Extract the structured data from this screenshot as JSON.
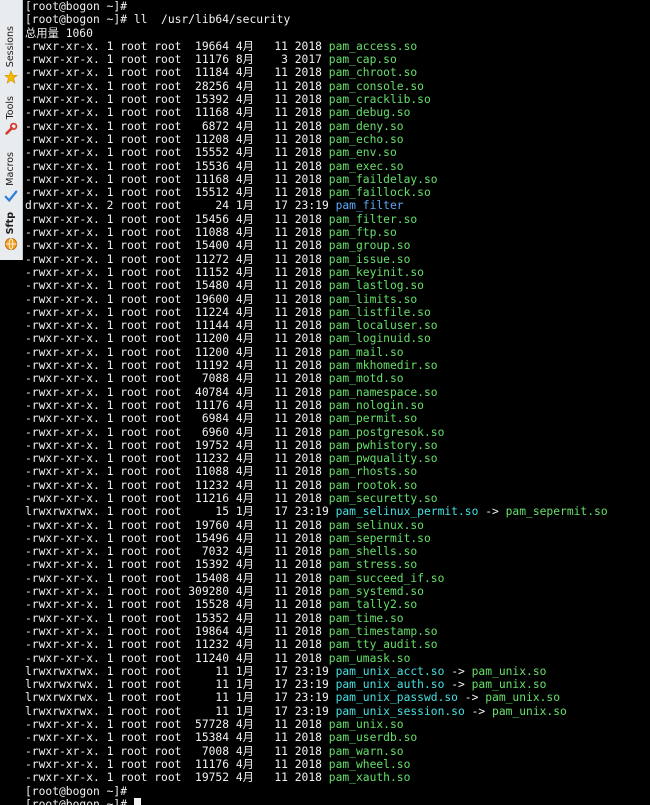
{
  "sidebar": {
    "tabs": [
      {
        "label": "Sessions",
        "icon": "star-icon"
      },
      {
        "label": "Tools",
        "icon": "wrench-icon"
      },
      {
        "label": "Macros",
        "icon": "checkmark-icon"
      },
      {
        "label": "Sftp",
        "icon": "globe-icon"
      }
    ]
  },
  "terminal": {
    "colors": {
      "executable": "#66e06a",
      "directory": "#5ba7f7",
      "symlink": "#47e0e0",
      "text": "#f2f2f2"
    },
    "lines": [
      {
        "text": "[root@bogon ~]#"
      },
      {
        "text": "[root@bogon ~]# ll  /usr/lib64/security"
      },
      {
        "text": "总用量 1060"
      },
      {
        "prefix": "-rwxr-xr-x. 1 root root  19664 4月   11 2018 ",
        "name": "pam_access.so",
        "type": "exec"
      },
      {
        "prefix": "-rwxr-xr-x. 1 root root  11176 8月    3 2017 ",
        "name": "pam_cap.so",
        "type": "exec"
      },
      {
        "prefix": "-rwxr-xr-x. 1 root root  11184 4月   11 2018 ",
        "name": "pam_chroot.so",
        "type": "exec"
      },
      {
        "prefix": "-rwxr-xr-x. 1 root root  28256 4月   11 2018 ",
        "name": "pam_console.so",
        "type": "exec"
      },
      {
        "prefix": "-rwxr-xr-x. 1 root root  15392 4月   11 2018 ",
        "name": "pam_cracklib.so",
        "type": "exec"
      },
      {
        "prefix": "-rwxr-xr-x. 1 root root  11168 4月   11 2018 ",
        "name": "pam_debug.so",
        "type": "exec"
      },
      {
        "prefix": "-rwxr-xr-x. 1 root root   6872 4月   11 2018 ",
        "name": "pam_deny.so",
        "type": "exec"
      },
      {
        "prefix": "-rwxr-xr-x. 1 root root  11208 4月   11 2018 ",
        "name": "pam_echo.so",
        "type": "exec"
      },
      {
        "prefix": "-rwxr-xr-x. 1 root root  15552 4月   11 2018 ",
        "name": "pam_env.so",
        "type": "exec"
      },
      {
        "prefix": "-rwxr-xr-x. 1 root root  15536 4月   11 2018 ",
        "name": "pam_exec.so",
        "type": "exec"
      },
      {
        "prefix": "-rwxr-xr-x. 1 root root  11168 4月   11 2018 ",
        "name": "pam_faildelay.so",
        "type": "exec"
      },
      {
        "prefix": "-rwxr-xr-x. 1 root root  15512 4月   11 2018 ",
        "name": "pam_faillock.so",
        "type": "exec"
      },
      {
        "prefix": "drwxr-xr-x. 2 root root     24 1月   17 23:19 ",
        "name": "pam_filter",
        "type": "dir"
      },
      {
        "prefix": "-rwxr-xr-x. 1 root root  15456 4月   11 2018 ",
        "name": "pam_filter.so",
        "type": "exec"
      },
      {
        "prefix": "-rwxr-xr-x. 1 root root  11088 4月   11 2018 ",
        "name": "pam_ftp.so",
        "type": "exec"
      },
      {
        "prefix": "-rwxr-xr-x. 1 root root  15400 4月   11 2018 ",
        "name": "pam_group.so",
        "type": "exec"
      },
      {
        "prefix": "-rwxr-xr-x. 1 root root  11272 4月   11 2018 ",
        "name": "pam_issue.so",
        "type": "exec"
      },
      {
        "prefix": "-rwxr-xr-x. 1 root root  11152 4月   11 2018 ",
        "name": "pam_keyinit.so",
        "type": "exec"
      },
      {
        "prefix": "-rwxr-xr-x. 1 root root  15480 4月   11 2018 ",
        "name": "pam_lastlog.so",
        "type": "exec"
      },
      {
        "prefix": "-rwxr-xr-x. 1 root root  19600 4月   11 2018 ",
        "name": "pam_limits.so",
        "type": "exec"
      },
      {
        "prefix": "-rwxr-xr-x. 1 root root  11224 4月   11 2018 ",
        "name": "pam_listfile.so",
        "type": "exec"
      },
      {
        "prefix": "-rwxr-xr-x. 1 root root  11144 4月   11 2018 ",
        "name": "pam_localuser.so",
        "type": "exec"
      },
      {
        "prefix": "-rwxr-xr-x. 1 root root  11200 4月   11 2018 ",
        "name": "pam_loginuid.so",
        "type": "exec"
      },
      {
        "prefix": "-rwxr-xr-x. 1 root root  11200 4月   11 2018 ",
        "name": "pam_mail.so",
        "type": "exec"
      },
      {
        "prefix": "-rwxr-xr-x. 1 root root  11192 4月   11 2018 ",
        "name": "pam_mkhomedir.so",
        "type": "exec"
      },
      {
        "prefix": "-rwxr-xr-x. 1 root root   7088 4月   11 2018 ",
        "name": "pam_motd.so",
        "type": "exec"
      },
      {
        "prefix": "-rwxr-xr-x. 1 root root  40784 4月   11 2018 ",
        "name": "pam_namespace.so",
        "type": "exec"
      },
      {
        "prefix": "-rwxr-xr-x. 1 root root  11176 4月   11 2018 ",
        "name": "pam_nologin.so",
        "type": "exec"
      },
      {
        "prefix": "-rwxr-xr-x. 1 root root   6984 4月   11 2018 ",
        "name": "pam_permit.so",
        "type": "exec"
      },
      {
        "prefix": "-rwxr-xr-x. 1 root root   6960 4月   11 2018 ",
        "name": "pam_postgresok.so",
        "type": "exec"
      },
      {
        "prefix": "-rwxr-xr-x. 1 root root  19752 4月   11 2018 ",
        "name": "pam_pwhistory.so",
        "type": "exec"
      },
      {
        "prefix": "-rwxr-xr-x. 1 root root  11232 4月   11 2018 ",
        "name": "pam_pwquality.so",
        "type": "exec"
      },
      {
        "prefix": "-rwxr-xr-x. 1 root root  11088 4月   11 2018 ",
        "name": "pam_rhosts.so",
        "type": "exec"
      },
      {
        "prefix": "-rwxr-xr-x. 1 root root  11232 4月   11 2018 ",
        "name": "pam_rootok.so",
        "type": "exec"
      },
      {
        "prefix": "-rwxr-xr-x. 1 root root  11216 4月   11 2018 ",
        "name": "pam_securetty.so",
        "type": "exec"
      },
      {
        "prefix": "lrwxrwxrwx. 1 root root     15 1月   17 23:19 ",
        "name": "pam_selinux_permit.so",
        "type": "link",
        "target": "pam_sepermit.so"
      },
      {
        "prefix": "-rwxr-xr-x. 1 root root  19760 4月   11 2018 ",
        "name": "pam_selinux.so",
        "type": "exec"
      },
      {
        "prefix": "-rwxr-xr-x. 1 root root  15496 4月   11 2018 ",
        "name": "pam_sepermit.so",
        "type": "exec"
      },
      {
        "prefix": "-rwxr-xr-x. 1 root root   7032 4月   11 2018 ",
        "name": "pam_shells.so",
        "type": "exec"
      },
      {
        "prefix": "-rwxr-xr-x. 1 root root  15392 4月   11 2018 ",
        "name": "pam_stress.so",
        "type": "exec"
      },
      {
        "prefix": "-rwxr-xr-x. 1 root root  15408 4月   11 2018 ",
        "name": "pam_succeed_if.so",
        "type": "exec"
      },
      {
        "prefix": "-rwxr-xr-x. 1 root root 309280 4月   11 2018 ",
        "name": "pam_systemd.so",
        "type": "exec"
      },
      {
        "prefix": "-rwxr-xr-x. 1 root root  15528 4月   11 2018 ",
        "name": "pam_tally2.so",
        "type": "exec"
      },
      {
        "prefix": "-rwxr-xr-x. 1 root root  15352 4月   11 2018 ",
        "name": "pam_time.so",
        "type": "exec"
      },
      {
        "prefix": "-rwxr-xr-x. 1 root root  19864 4月   11 2018 ",
        "name": "pam_timestamp.so",
        "type": "exec"
      },
      {
        "prefix": "-rwxr-xr-x. 1 root root  11232 4月   11 2018 ",
        "name": "pam_tty_audit.so",
        "type": "exec"
      },
      {
        "prefix": "-rwxr-xr-x. 1 root root  11240 4月   11 2018 ",
        "name": "pam_umask.so",
        "type": "exec"
      },
      {
        "prefix": "lrwxrwxrwx. 1 root root     11 1月   17 23:19 ",
        "name": "pam_unix_acct.so",
        "type": "link",
        "target": "pam_unix.so"
      },
      {
        "prefix": "lrwxrwxrwx. 1 root root     11 1月   17 23:19 ",
        "name": "pam_unix_auth.so",
        "type": "link",
        "target": "pam_unix.so"
      },
      {
        "prefix": "lrwxrwxrwx. 1 root root     11 1月   17 23:19 ",
        "name": "pam_unix_passwd.so",
        "type": "link",
        "target": "pam_unix.so"
      },
      {
        "prefix": "lrwxrwxrwx. 1 root root     11 1月   17 23:19 ",
        "name": "pam_unix_session.so",
        "type": "link",
        "target": "pam_unix.so"
      },
      {
        "prefix": "-rwxr-xr-x. 1 root root  57728 4月   11 2018 ",
        "name": "pam_unix.so",
        "type": "exec"
      },
      {
        "prefix": "-rwxr-xr-x. 1 root root  15384 4月   11 2018 ",
        "name": "pam_userdb.so",
        "type": "exec"
      },
      {
        "prefix": "-rwxr-xr-x. 1 root root   7008 4月   11 2018 ",
        "name": "pam_warn.so",
        "type": "exec"
      },
      {
        "prefix": "-rwxr-xr-x. 1 root root  11176 4月   11 2018 ",
        "name": "pam_wheel.so",
        "type": "exec"
      },
      {
        "prefix": "-rwxr-xr-x. 1 root root  19752 4月   11 2018 ",
        "name": "pam_xauth.so",
        "type": "exec"
      },
      {
        "text": "[root@bogon ~]#"
      },
      {
        "text": "[root@bogon ~]# ",
        "cursor": true
      }
    ]
  }
}
